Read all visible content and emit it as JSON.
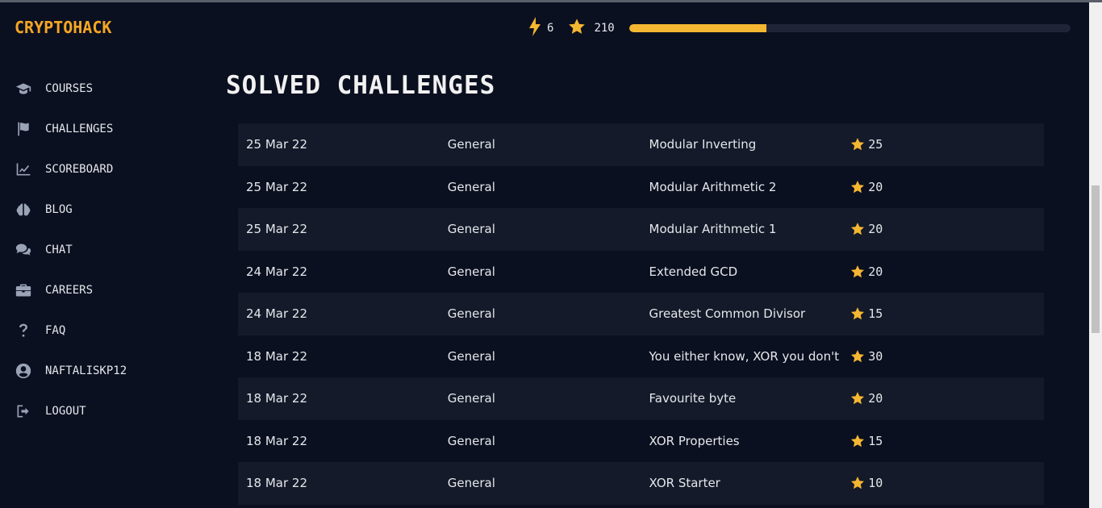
{
  "brand": {
    "logo": "CRYPTOHACK",
    "accent": "#f5a623"
  },
  "stats": {
    "streak": "6",
    "score": "210",
    "progress_fraction": 0.31
  },
  "nav": [
    {
      "label": "COURSES",
      "icon": "graduation-cap-icon"
    },
    {
      "label": "CHALLENGES",
      "icon": "flag-icon"
    },
    {
      "label": "SCOREBOARD",
      "icon": "chart-line-icon"
    },
    {
      "label": "BLOG",
      "icon": "brain-icon"
    },
    {
      "label": "CHAT",
      "icon": "comments-icon"
    },
    {
      "label": "CAREERS",
      "icon": "briefcase-icon"
    },
    {
      "label": "FAQ",
      "icon": "question-icon"
    },
    {
      "label": "NAFTALISKP12",
      "icon": "user-circle-icon"
    },
    {
      "label": "LOGOUT",
      "icon": "sign-out-icon"
    }
  ],
  "page": {
    "title": "SOLVED CHALLENGES"
  },
  "solved": [
    {
      "date": "25 Mar 22",
      "category": "General",
      "name": "Modular Inverting",
      "points": "25"
    },
    {
      "date": "25 Mar 22",
      "category": "General",
      "name": "Modular Arithmetic 2",
      "points": "20"
    },
    {
      "date": "25 Mar 22",
      "category": "General",
      "name": "Modular Arithmetic 1",
      "points": "20"
    },
    {
      "date": "24 Mar 22",
      "category": "General",
      "name": "Extended GCD",
      "points": "20"
    },
    {
      "date": "24 Mar 22",
      "category": "General",
      "name": "Greatest Common Divisor",
      "points": "15"
    },
    {
      "date": "18 Mar 22",
      "category": "General",
      "name": "You either know, XOR you don't",
      "points": "30"
    },
    {
      "date": "18 Mar 22",
      "category": "General",
      "name": "Favourite byte",
      "points": "20"
    },
    {
      "date": "18 Mar 22",
      "category": "General",
      "name": "XOR Properties",
      "points": "15"
    },
    {
      "date": "18 Mar 22",
      "category": "General",
      "name": "XOR Starter",
      "points": "10"
    }
  ]
}
